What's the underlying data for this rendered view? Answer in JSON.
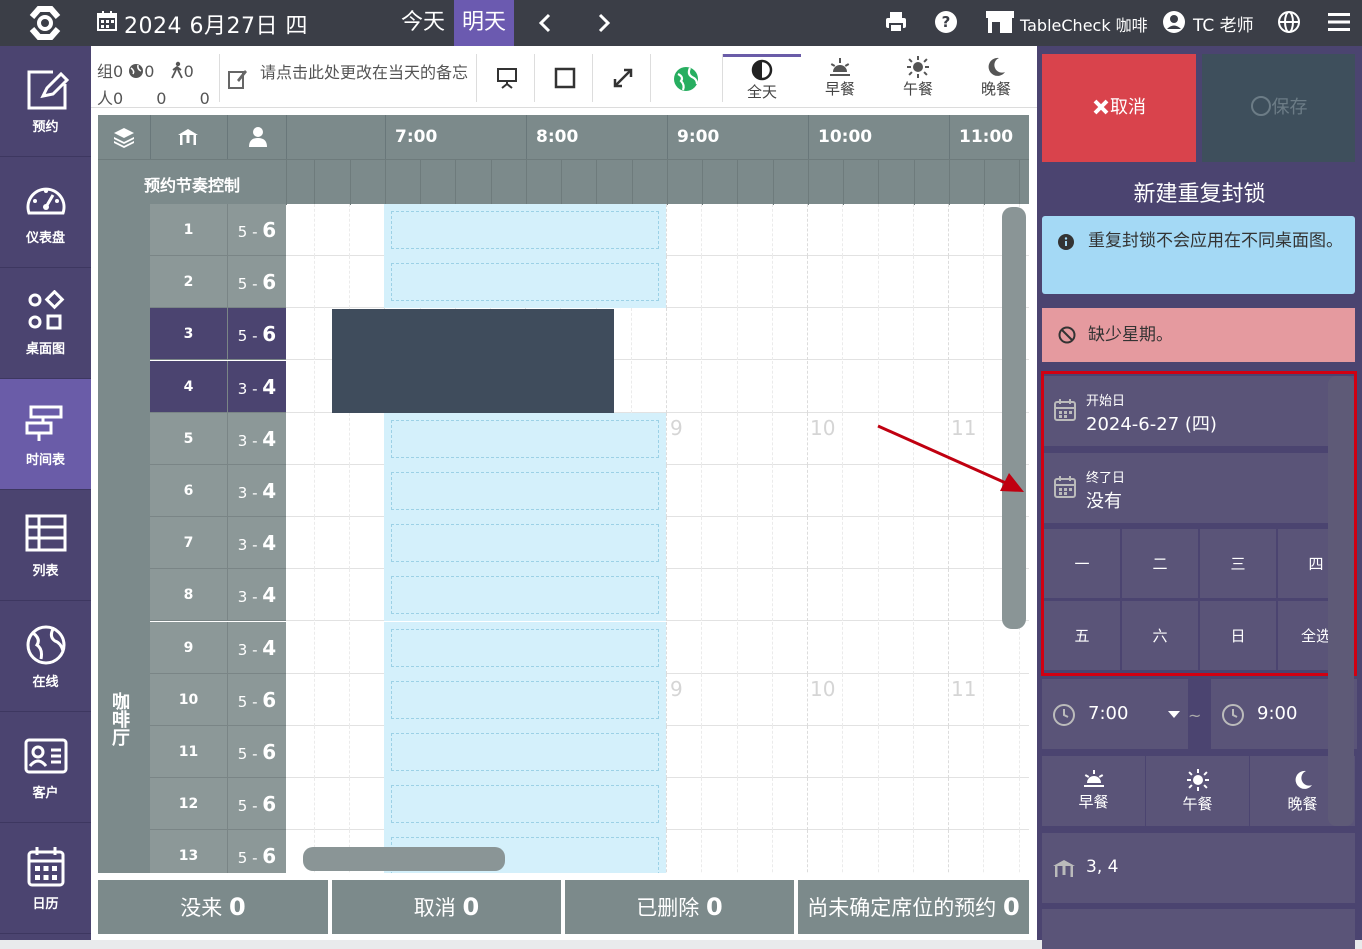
{
  "topbar": {
    "date": "2024 6月27日 四",
    "today": "今天",
    "tomorrow": "明天",
    "store": "TableCheck 咖啡",
    "user": "TC 老师",
    "icons": [
      "logo-icon",
      "calendar-icon",
      "chevron-left-icon",
      "chevron-right-icon",
      "print-icon",
      "help-icon",
      "store-icon",
      "user-icon",
      "globe-icon",
      "menu-icon"
    ]
  },
  "sidebar": {
    "items": [
      {
        "label": "预约",
        "icon": "edit-icon"
      },
      {
        "label": "仪表盘",
        "icon": "dashboard-icon"
      },
      {
        "label": "桌面图",
        "icon": "floorplan-icon"
      },
      {
        "label": "时间表",
        "icon": "timeline-icon"
      },
      {
        "label": "列表",
        "icon": "list-icon"
      },
      {
        "label": "在线",
        "icon": "online-icon"
      },
      {
        "label": "客户",
        "icon": "customer-icon"
      },
      {
        "label": "日历",
        "icon": "calendar-icon"
      }
    ],
    "active": "时间表"
  },
  "toolbar": {
    "groups_label": "组",
    "people_label": "人",
    "count_groups": "0",
    "count_people": "0",
    "count_online_groups": "0",
    "count_online_people": "0",
    "count_walkin_groups": "0",
    "count_walkin_people": "0",
    "memo": "请点击此处更改在当天的备忘",
    "meals": [
      {
        "label": "全天",
        "icon": "all-day-icon"
      },
      {
        "label": "早餐",
        "icon": "sunrise-icon"
      },
      {
        "label": "午餐",
        "icon": "sun-icon"
      },
      {
        "label": "晚餐",
        "icon": "moon-icon"
      }
    ]
  },
  "timeline": {
    "times": [
      "7:00",
      "8:00",
      "9:00",
      "10:00",
      "11:00"
    ],
    "section_label": "预约节奏控制",
    "area": "咖啡厅",
    "rows": [
      {
        "table": "1",
        "cap_min": "5",
        "cap_max": "6"
      },
      {
        "table": "2",
        "cap_min": "5",
        "cap_max": "6"
      },
      {
        "table": "3",
        "cap_min": "5",
        "cap_max": "6",
        "selected": true
      },
      {
        "table": "4",
        "cap_min": "3",
        "cap_max": "4",
        "selected": true
      },
      {
        "table": "5",
        "cap_min": "3",
        "cap_max": "4"
      },
      {
        "table": "6",
        "cap_min": "3",
        "cap_max": "4"
      },
      {
        "table": "7",
        "cap_min": "3",
        "cap_max": "4"
      },
      {
        "table": "8",
        "cap_min": "3",
        "cap_max": "4"
      },
      {
        "table": "9",
        "cap_min": "3",
        "cap_max": "4"
      },
      {
        "table": "10",
        "cap_min": "5",
        "cap_max": "6"
      },
      {
        "table": "11",
        "cap_min": "5",
        "cap_max": "6"
      },
      {
        "table": "12",
        "cap_min": "5",
        "cap_max": "6"
      },
      {
        "table": "13",
        "cap_min": "5",
        "cap_max": "6"
      }
    ],
    "ghost_hours": [
      "9",
      "10",
      "11"
    ]
  },
  "footer": {
    "noshow": "没来",
    "noshow_count": "0",
    "cancel": "取消",
    "cancel_count": "0",
    "deleted": "已删除",
    "deleted_count": "0",
    "unseated": "尚未确定席位的预约",
    "unseated_count": "0"
  },
  "panel": {
    "cancel_label": "取消",
    "save_label": "保存",
    "title": "新建重复封锁",
    "info": "重复封锁不会应用在不同桌面图。",
    "error": "缺少星期。",
    "start_label": "开始日",
    "start_value": "2024-6-27 (四)",
    "end_label": "终了日",
    "end_value": "没有",
    "weekdays": [
      "一",
      "二",
      "三",
      "四",
      "五",
      "六",
      "日",
      "全选"
    ],
    "time_from": "7:00",
    "time_to": "9:00",
    "tilde": "~",
    "meals": [
      "早餐",
      "午餐",
      "晚餐"
    ],
    "tables": "3, 4"
  },
  "colors": {
    "topbar": "#3b3e47",
    "sidebar": "#4b4470",
    "accent": "#6a5ca8",
    "cancel": "#d9434c",
    "info": "#a4d9f5",
    "error": "#e59a9f",
    "highlight": "#d10011",
    "block": "#d4f0fb",
    "block_dark": "#3f4c5c"
  }
}
